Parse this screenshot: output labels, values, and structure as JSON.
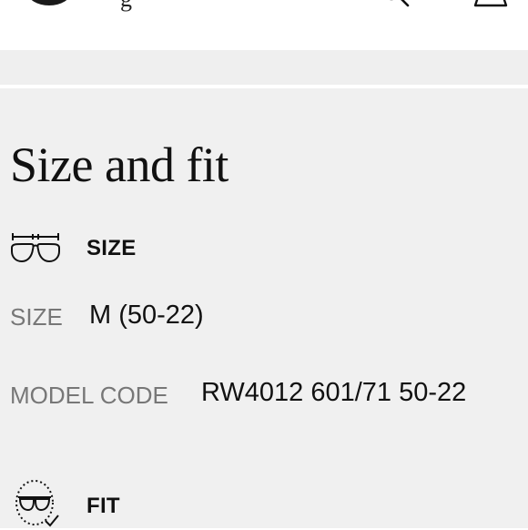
{
  "header": {
    "brand_text": "g",
    "logo_icon": "brand-logo",
    "search_icon": "search-icon",
    "bag_icon": "shopping-bag-icon"
  },
  "size_and_fit": {
    "title": "Size and fit",
    "size_section": {
      "heading": "SIZE",
      "icon": "glasses-measure-icon",
      "size_label": "SIZE",
      "size_value": "M (50-22)",
      "model_code_label": "MODEL CODE",
      "model_code_value": "RW4012 601/71 50-22"
    },
    "fit_section": {
      "heading": "FIT",
      "icon": "face-glasses-check-icon"
    }
  },
  "colors": {
    "panel_background": "#f0f0f0",
    "label_gray": "#777777",
    "text_dark": "#111111"
  }
}
